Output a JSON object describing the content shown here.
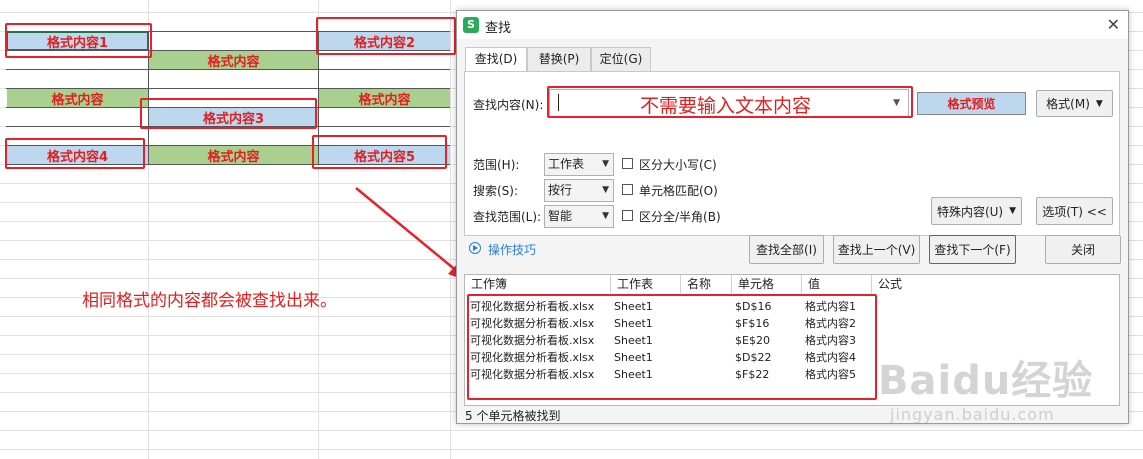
{
  "sheet": {
    "cells": [
      "格式内容1",
      "格式内容",
      "格式内容2",
      "格式内容",
      "格式内容",
      "格式内容3",
      "格式内容4",
      "格式内容",
      "格式内容5"
    ],
    "annotation": "相同格式的内容都会被查找出来。"
  },
  "dialog": {
    "title": "查找",
    "app_icon": "S",
    "tabs": [
      "查找(D)",
      "替换(P)",
      "定位(G)"
    ],
    "find_label": "查找内容(N):",
    "find_value": "",
    "find_hint": "不需要输入文本内容",
    "format_preview": "格式预览",
    "format_button": "格式(M)",
    "scope_label": "范围(H):",
    "scope_value": "工作表",
    "search_label": "搜索(S):",
    "search_value": "按行",
    "lookin_label": "查找范围(L):",
    "lookin_value": "智能",
    "match_case": "区分大小写(C)",
    "match_cell": "单元格匹配(O)",
    "match_width": "区分全/半角(B)",
    "special_button": "特殊内容(U)",
    "options_button": "选项(T) <<",
    "tips": "操作技巧",
    "find_all": "查找全部(I)",
    "find_prev": "查找上一个(V)",
    "find_next": "查找下一个(F)",
    "close": "关闭",
    "columns": [
      "工作簿",
      "工作表",
      "名称",
      "单元格",
      "值",
      "公式"
    ],
    "results": [
      {
        "book": "可视化数据分析看板.xlsx",
        "sheet": "Sheet1",
        "name": "",
        "cell": "$D$16",
        "value": "格式内容1"
      },
      {
        "book": "可视化数据分析看板.xlsx",
        "sheet": "Sheet1",
        "name": "",
        "cell": "$F$16",
        "value": "格式内容2"
      },
      {
        "book": "可视化数据分析看板.xlsx",
        "sheet": "Sheet1",
        "name": "",
        "cell": "$E$20",
        "value": "格式内容3"
      },
      {
        "book": "可视化数据分析看板.xlsx",
        "sheet": "Sheet1",
        "name": "",
        "cell": "$D$22",
        "value": "格式内容4"
      },
      {
        "book": "可视化数据分析看板.xlsx",
        "sheet": "Sheet1",
        "name": "",
        "cell": "$F$22",
        "value": "格式内容5"
      }
    ],
    "status": "5 个单元格被找到"
  },
  "watermark": {
    "brand": "Baidu经验",
    "url": "jingyan.baidu.com"
  },
  "colors": {
    "accent_red": "#e8202a",
    "cell_blue": "#bdd7ee",
    "cell_green": "#a9d08e",
    "link_blue": "#2a7fd4"
  }
}
